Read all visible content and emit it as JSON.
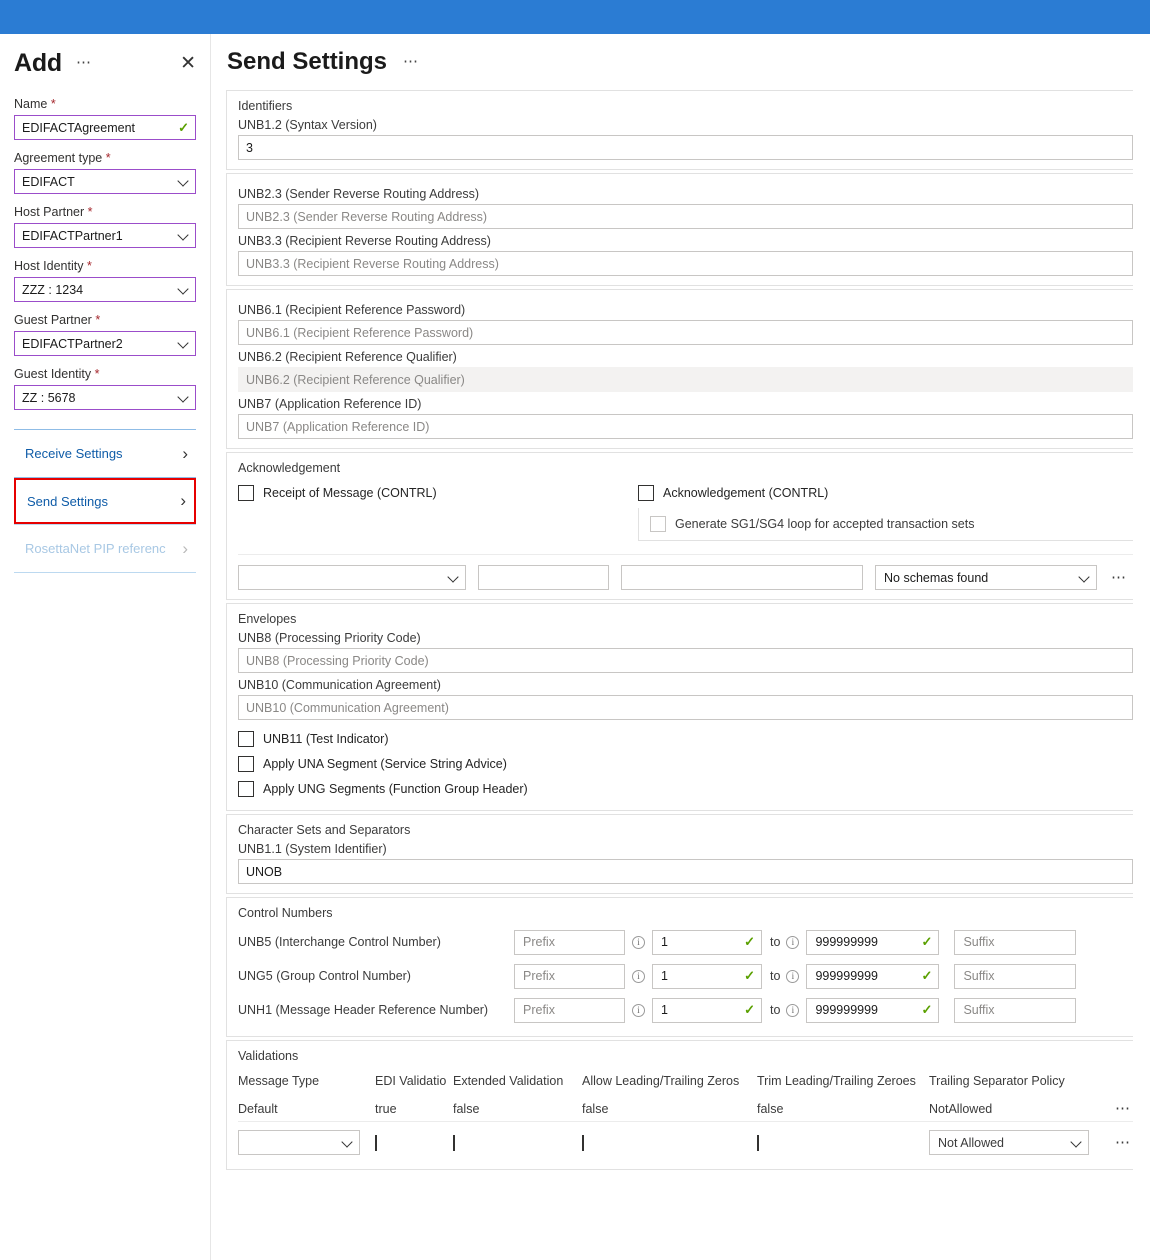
{
  "sidebar": {
    "title": "Add",
    "more_icon": "ellipsis-icon",
    "close_icon": "close-icon",
    "fields": [
      {
        "label": "Name",
        "required": "*",
        "value": "EDIFACTAgreement",
        "kind": "text-valid"
      },
      {
        "label": "Agreement type",
        "required": "*",
        "value": "EDIFACT",
        "kind": "select"
      },
      {
        "label": "Host Partner",
        "required": "*",
        "value": "EDIFACTPartner1",
        "kind": "select"
      },
      {
        "label": "Host Identity",
        "required": "*",
        "value": "ZZZ : 1234",
        "kind": "select"
      },
      {
        "label": "Guest Partner",
        "required": "*",
        "value": "EDIFACTPartner2",
        "kind": "select"
      },
      {
        "label": "Guest Identity",
        "required": "*",
        "value": "ZZ : 5678",
        "kind": "select"
      }
    ],
    "nav": [
      {
        "label": "Receive Settings",
        "state": "normal"
      },
      {
        "label": "Send Settings",
        "state": "selected"
      },
      {
        "label": "RosettaNet PIP referenc",
        "state": "disabled"
      }
    ]
  },
  "main": {
    "title": "Send Settings",
    "more_icon": "ellipsis-icon",
    "identifiers": {
      "section": "Identifiers",
      "syntax_label": "UNB1.2 (Syntax Version)",
      "syntax_value": "3"
    },
    "routing": {
      "fields": [
        {
          "label": "UNB2.3 (Sender Reverse Routing Address)",
          "placeholder": "UNB2.3 (Sender Reverse Routing Address)",
          "value": ""
        },
        {
          "label": "UNB3.3 (Recipient Reverse Routing Address)",
          "placeholder": "UNB3.3 (Recipient Reverse Routing Address)",
          "value": ""
        }
      ]
    },
    "references": {
      "fields": [
        {
          "label": "UNB6.1 (Recipient Reference Password)",
          "placeholder": "UNB6.1 (Recipient Reference Password)",
          "value": "",
          "hover": false
        },
        {
          "label": "UNB6.2 (Recipient Reference Qualifier)",
          "placeholder": "UNB6.2 (Recipient Reference Qualifier)",
          "value": "",
          "hover": true
        },
        {
          "label": "UNB7 (Application Reference ID)",
          "placeholder": "UNB7 (Application Reference ID)",
          "value": "",
          "hover": false
        }
      ]
    },
    "acknowledgement": {
      "section": "Acknowledgement",
      "receipt_label": "Receipt of Message (CONTRL)",
      "receipt_checked": false,
      "ack_label": "Acknowledgement (CONTRL)",
      "ack_checked": false,
      "sg_label": "Generate SG1/SG4 loop for accepted transaction sets",
      "sg_checked": false,
      "sg_disabled": true,
      "row": {
        "select1_value": "",
        "input2_value": "",
        "input3_value": "",
        "schema_value": "No schemas found",
        "more_icon": "ellipsis-icon"
      }
    },
    "envelopes": {
      "section": "Envelopes",
      "fields": [
        {
          "label": "UNB8 (Processing Priority Code)",
          "placeholder": "UNB8 (Processing Priority Code)",
          "value": ""
        },
        {
          "label": "UNB10 (Communication Agreement)",
          "placeholder": "UNB10 (Communication Agreement)",
          "value": ""
        }
      ],
      "checkboxes": [
        {
          "label": "UNB11 (Test Indicator)",
          "checked": false
        },
        {
          "label": "Apply UNA Segment (Service String Advice)",
          "checked": false
        },
        {
          "label": "Apply UNG Segments (Function Group Header)",
          "checked": false
        }
      ]
    },
    "charsets": {
      "section": "Character Sets and Separators",
      "label": "UNB1.1 (System Identifier)",
      "value": "UNOB"
    },
    "control_numbers": {
      "section": "Control Numbers",
      "prefix_placeholder": "Prefix",
      "suffix_placeholder": "Suffix",
      "to_label": "to",
      "info_icon": "info-icon",
      "rows": [
        {
          "label": "UNB5 (Interchange Control Number)",
          "prefix": "",
          "from": "1",
          "upto": "999999999",
          "suffix": ""
        },
        {
          "label": "UNG5 (Group Control Number)",
          "prefix": "",
          "from": "1",
          "upto": "999999999",
          "suffix": ""
        },
        {
          "label": "UNH1 (Message Header Reference Number)",
          "prefix": "",
          "from": "1",
          "upto": "999999999",
          "suffix": ""
        }
      ]
    },
    "validations": {
      "section": "Validations",
      "columns": [
        "Message Type",
        "EDI Validatio",
        "Extended Validation",
        "Allow Leading/Trailing Zeros",
        "Trim Leading/Trailing Zeroes",
        "Trailing Separator Policy"
      ],
      "rows": [
        {
          "message_type": "Default",
          "edi_validation": "true",
          "extended_validation": "false",
          "allow_zeros": "false",
          "trim_zeros": "false",
          "separator_policy": "NotAllowed",
          "more_icon": "ellipsis-icon"
        }
      ],
      "new_row": {
        "message_type": "",
        "edi_validation_checked": false,
        "extended_validation_checked": false,
        "allow_zeros_checked": false,
        "trim_zeros_checked": false,
        "separator_policy": "Not Allowed",
        "more_icon": "ellipsis-icon"
      }
    }
  },
  "theme": {
    "topbar_color": "#2b7cd3",
    "accent_link": "#0f5ca8",
    "highlight_border": "#e60000",
    "field_border": "#9b4dca",
    "valid_check": "#5aa000"
  }
}
